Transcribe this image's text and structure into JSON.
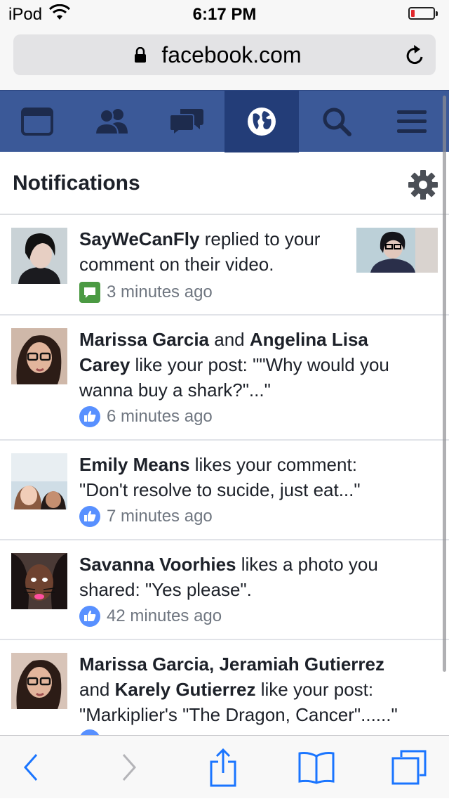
{
  "status_bar": {
    "carrier": "iPod",
    "time": "6:17 PM",
    "wifi_icon": "wifi-icon",
    "battery_level": 0.1
  },
  "browser": {
    "url": "facebook.com",
    "lock_icon": "lock-icon",
    "reload_icon": "reload-icon"
  },
  "fb_nav": [
    {
      "name": "news-feed",
      "icon": "news-feed-icon",
      "active": false
    },
    {
      "name": "friend-requests",
      "icon": "friends-icon",
      "active": false
    },
    {
      "name": "messages",
      "icon": "messages-icon",
      "active": false
    },
    {
      "name": "notifications",
      "icon": "globe-icon",
      "active": true
    },
    {
      "name": "search",
      "icon": "search-icon",
      "active": false
    },
    {
      "name": "menu",
      "icon": "hamburger-menu-icon",
      "active": false
    }
  ],
  "header": {
    "title": "Notifications",
    "settings_icon": "gear-icon"
  },
  "notifications": [
    {
      "actor1": "SayWeCanFly",
      "text1": " replied to your",
      "text2": "comment on their video.",
      "time": "3 minutes ago",
      "type_icon": "comment-icon"
    },
    {
      "actor1": "Marissa Garcia",
      "mid": " and ",
      "actor2": "Angelina Lisa",
      "actor2b": "Carey",
      "text1": " like your post: \"\"Why would you",
      "text2": "wanna buy a shark?\"...\"",
      "time": "6 minutes ago",
      "type_icon": "like-icon"
    },
    {
      "actor1": "Emily Means",
      "text1": " likes your comment:",
      "text2": "\"Don't resolve to sucide, just eat...\"",
      "time": "7 minutes ago",
      "type_icon": "like-icon"
    },
    {
      "actor1": "Savanna Voorhies",
      "text1": " likes a photo you",
      "text2": "shared: \"Yes please\".",
      "time": "42 minutes ago",
      "type_icon": "like-icon"
    },
    {
      "actor1": "Marissa Garcia, Jeramiah Gutierrez",
      "mid": "and ",
      "actor2": "Karely Gutierrez",
      "text1": " like your post:",
      "text2": "\"Markiplier's \"The Dragon, Cancer\"......\"",
      "type_icon": "like-icon"
    }
  ],
  "toolbar": [
    {
      "name": "back",
      "icon": "back-arrow-icon"
    },
    {
      "name": "forward",
      "icon": "forward-arrow-icon"
    },
    {
      "name": "share",
      "icon": "share-icon"
    },
    {
      "name": "bookmarks",
      "icon": "bookmarks-icon"
    },
    {
      "name": "tabs",
      "icon": "tabs-icon"
    }
  ],
  "colors": {
    "fb_blue": "#3b5998",
    "fb_active": "#233d78",
    "ios_blue": "#1a75ff",
    "like_blue": "#5890ff",
    "comment_green": "#4b9a43"
  }
}
